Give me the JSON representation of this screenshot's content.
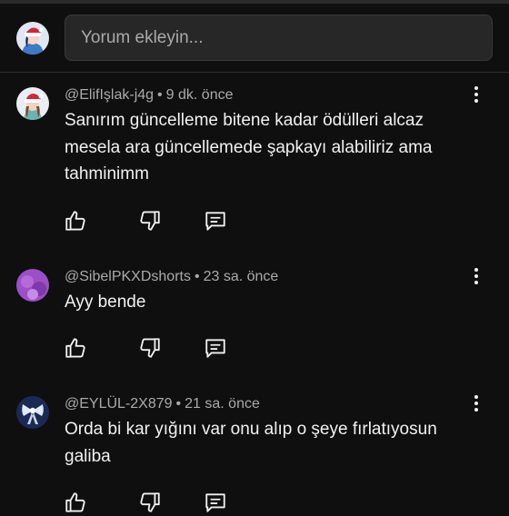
{
  "composer": {
    "placeholder": "Yorum ekleyin...",
    "avatar_icon": "santa-hat-avatar-icon"
  },
  "comments": [
    {
      "author": "@ElifIşlak-j4g",
      "time": "9 dk. önce",
      "text": [
        "Sanırım güncelleme bitene kadar ödülleri alcaz",
        "mesela ara güncellemede şapkayı alabiliriz ama",
        "tahminimm"
      ],
      "avatar_icon": "santa-hat-avatar-icon"
    },
    {
      "author": "@SibelPKXDshorts",
      "time": "23 sa. önce",
      "text": [
        "Ayy bende"
      ],
      "avatar_icon": "purple-avatar-icon"
    },
    {
      "author": "@EYLÜL-2X879",
      "time": "21 sa. önce",
      "text": [
        "Orda bi kar yığını var onu alıp o şeye fırlatıyosun",
        "galiba"
      ],
      "avatar_icon": "bow-avatar-icon"
    }
  ],
  "icons": {
    "like": "thumb-up-icon",
    "dislike": "thumb-down-icon",
    "reply": "reply-comment-icon",
    "more": "more-vertical-icon"
  },
  "meta_separator": "•",
  "colors": {
    "background": "#0f0f0f",
    "input_background": "#272727",
    "meta_text": "#aaaaaa",
    "primary_text": "#f1f1f1"
  }
}
